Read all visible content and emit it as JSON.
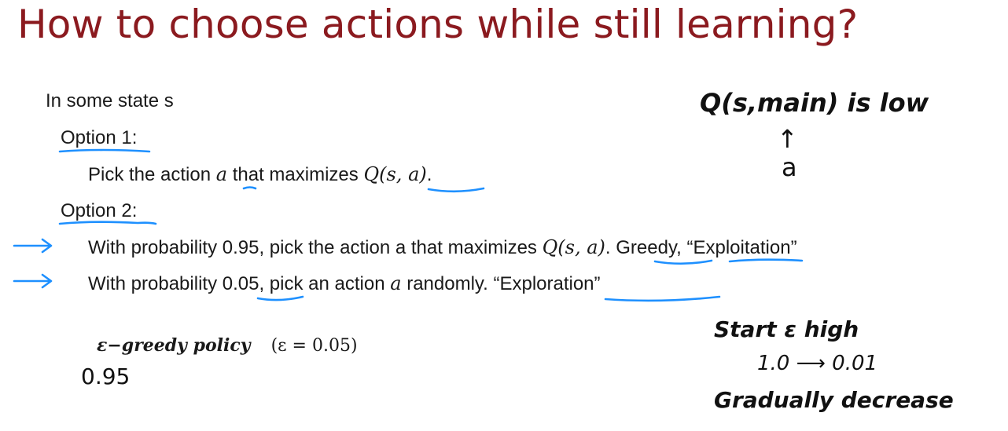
{
  "slide": {
    "title": "How to choose actions while still learning?",
    "state_line": "In some state s",
    "option1": {
      "label": "Option 1",
      "colon": ":",
      "text_pre": "Pick the action ",
      "var_a": "a",
      "text_mid": " that maximizes ",
      "q_expr": "Q(s, a)",
      "end": "."
    },
    "option2": {
      "label": "Option 2",
      "colon": ":",
      "line1": {
        "pre": "With probability 0.95, pick the action a that maximizes ",
        "q_expr": "Q(s, a)",
        "mid": ". ",
        "greedy": "Greedy",
        "post": ", “Exploitation”"
      },
      "line2": {
        "pre": "With probability ",
        "prob": "0.05",
        "mid": ", pick an action ",
        "var_a": "a",
        "mid2": " randomly. ",
        "exploration": "“Exploration”"
      }
    },
    "policy": {
      "name": "ε−greedy policy",
      "param": "(ε = 0.05)"
    }
  },
  "handwritten": {
    "q_low": "Q(s,main) is low",
    "up_arrow": "↑",
    "a_label": "a",
    "value_095": "0.95",
    "start_eps": "Start ε high",
    "range_start": "1.0",
    "range_arrow": "⟶",
    "range_end": "0.01",
    "gradually": "Gradually decrease"
  },
  "colors": {
    "title": "#8b1a1f",
    "annotation_blue": "#1e90ff",
    "text": "#1a1a1a"
  }
}
